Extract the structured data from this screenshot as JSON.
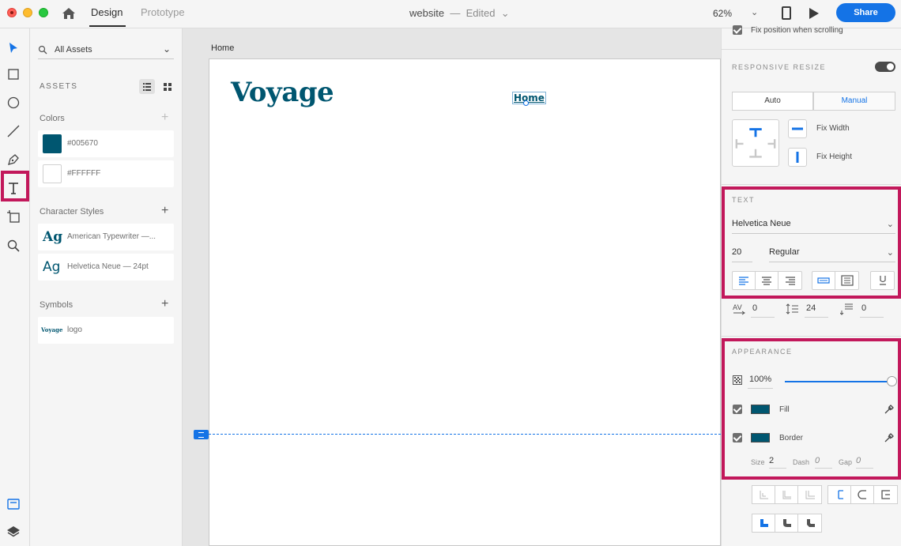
{
  "titlebar": {
    "tabs": [
      {
        "label": "Design",
        "active": true
      },
      {
        "label": "Prototype",
        "active": false
      }
    ],
    "doc_name": "website",
    "doc_sep": "—",
    "doc_status": "Edited",
    "zoom": "62%",
    "share_label": "Share"
  },
  "toolbar": {
    "tools": [
      "select-icon",
      "rectangle-icon",
      "ellipse-icon",
      "line-icon",
      "pen-icon",
      "text-icon",
      "artboard-icon",
      "zoom-icon"
    ],
    "active_tool": "text-icon",
    "bottom": [
      "assets-icon",
      "layers-icon"
    ]
  },
  "assets": {
    "filter": "All Assets",
    "heading": "ASSETS",
    "colors_label": "Colors",
    "colors": [
      {
        "hex": "#005670",
        "label": "#005670"
      },
      {
        "hex": "#FFFFFF",
        "label": "#FFFFFF"
      }
    ],
    "char_styles_label": "Character Styles",
    "char_styles": [
      {
        "glyph": "Ag",
        "label": "American Typewriter —..."
      },
      {
        "glyph": "Ag",
        "label": "Helvetica Neue — 24pt"
      }
    ],
    "symbols_label": "Symbols",
    "symbols": [
      {
        "thumb": "Voyage",
        "label": "logo"
      }
    ]
  },
  "canvas": {
    "artboard_name": "Home",
    "logo_text": "Voyage",
    "nav_text": "Home",
    "accent": "#1473e6",
    "brand_color": "#005670"
  },
  "inspector": {
    "fix_position_label": "Fix position when scrolling",
    "responsive_label": "RESPONSIVE RESIZE",
    "responsive_on": true,
    "seg_auto": "Auto",
    "seg_manual": "Manual",
    "fix_width": "Fix Width",
    "fix_height": "Fix Height",
    "text_heading": "TEXT",
    "font_family": "Helvetica Neue",
    "font_size": "20",
    "font_weight": "Regular",
    "char_spacing": "0",
    "line_spacing": "24",
    "para_spacing": "0",
    "appearance_heading": "APPEARANCE",
    "opacity": "100%",
    "opacity_value": 1.0,
    "fill_label": "Fill",
    "border_label": "Border",
    "size_label": "Size",
    "size_val": "2",
    "dash_label": "Dash",
    "dash_val": "0",
    "gap_label": "Gap",
    "gap_val": "0",
    "highlight_color": "#c2185b"
  }
}
